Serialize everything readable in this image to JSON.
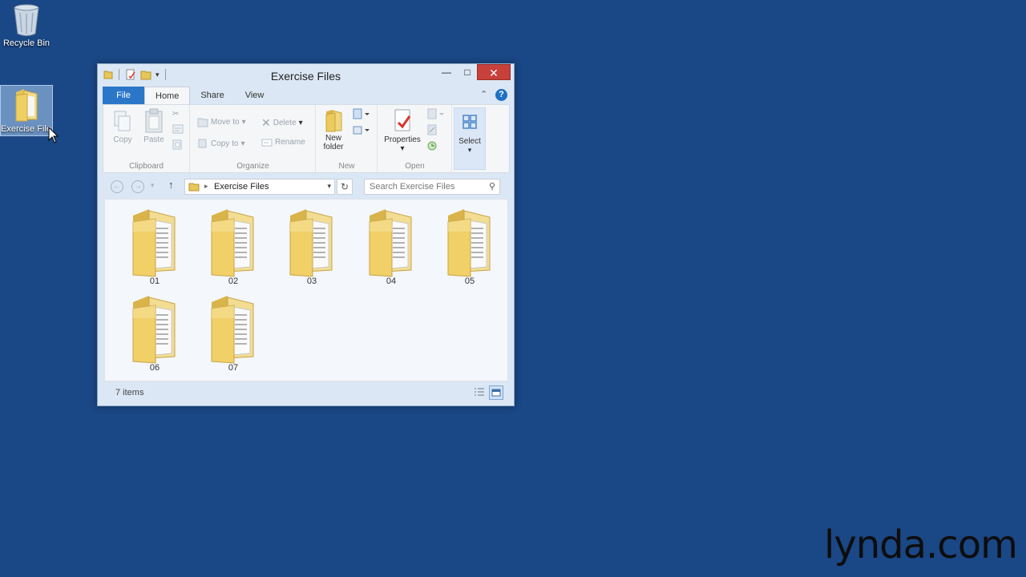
{
  "desktop": {
    "recycle_bin_label": "Recycle Bin",
    "exercise_files_label": "Exercise Files"
  },
  "window": {
    "title": "Exercise Files",
    "tabs": [
      "File",
      "Home",
      "Share",
      "View"
    ],
    "active_tab": "Home",
    "ribbon": {
      "clipboard": {
        "label": "Clipboard",
        "copy": "Copy",
        "paste": "Paste"
      },
      "organize": {
        "label": "Organize",
        "move_to": "Move to",
        "copy_to": "Copy to",
        "delete": "Delete",
        "rename": "Rename"
      },
      "new": {
        "label": "New",
        "new_folder_line1": "New",
        "new_folder_line2": "folder"
      },
      "open": {
        "label": "Open",
        "properties": "Properties"
      },
      "select": {
        "label": "Select"
      }
    },
    "address": {
      "path": "Exercise Files"
    },
    "search": {
      "placeholder": "Search Exercise Files"
    },
    "folders": [
      "01",
      "02",
      "03",
      "04",
      "05",
      "06",
      "07"
    ],
    "status": {
      "item_count": "7 items"
    }
  },
  "watermark": "lynda.com"
}
